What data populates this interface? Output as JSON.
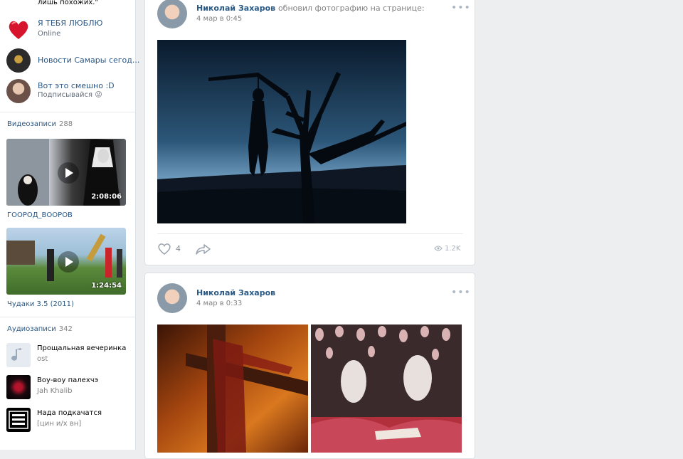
{
  "left_column": {
    "top_fragment": "лишь похожих.\"",
    "groups": [
      {
        "title": "Я ТЕБЯ ЛЮБЛЮ",
        "subtitle": "Online",
        "icon": "heart-icon"
      },
      {
        "title": "Новости Самары сегод...",
        "subtitle": ""
      },
      {
        "title": "Вот это смешно :D",
        "subtitle": "Подписывайся 😜"
      }
    ],
    "videos_section": {
      "title": "Видеозаписи",
      "count": "288",
      "items": [
        {
          "duration": "2:08:06",
          "title": "ГООРОД_ВООРОВ"
        },
        {
          "duration": "1:24:54",
          "title": "Чудаки 3.5 (2011)"
        }
      ]
    },
    "audio_section": {
      "title": "Аудиозаписи",
      "count": "342",
      "items": [
        {
          "title": "Прощальная вечеринка",
          "artist": "ost",
          "icon": "music-note-icon"
        },
        {
          "title": "Воу-воу палехчэ",
          "artist": "Jah Khalib"
        },
        {
          "title": "Нада подкачатся",
          "artist": "[цин и/х вн]"
        }
      ]
    }
  },
  "posts": [
    {
      "author": "Николай Захаров",
      "action": "обновил фотографию на странице:",
      "date": "4 мар в 0:45",
      "likes": "4",
      "views": "1.2K"
    },
    {
      "author": "Николай Захаров",
      "action": "",
      "date": "4 мар в 0:33"
    }
  ],
  "colors": {
    "link": "#2a5885",
    "background": "#edeef0",
    "secondary_text": "#828282"
  }
}
